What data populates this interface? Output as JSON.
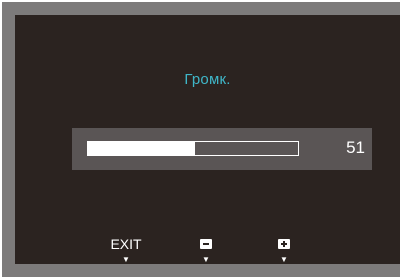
{
  "osd": {
    "title": "Громк.",
    "volume_value": "51",
    "volume_level": 0.51
  },
  "buttons": {
    "exit_label": "EXIT",
    "minus_icon": "minus-icon",
    "plus_icon": "plus-icon",
    "arrow_glyph": "▼"
  },
  "colors": {
    "title": "#3fb6c8",
    "screen_bg": "#2b2320",
    "panel_bg": "#5a5555",
    "frame": "#7d7b7b"
  }
}
